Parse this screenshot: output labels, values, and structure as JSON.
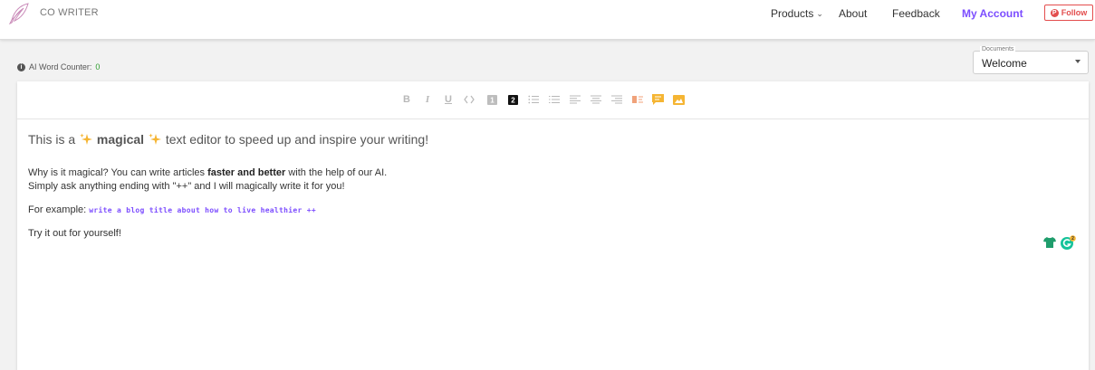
{
  "app": {
    "brand": "CO WRITER",
    "logo_icon": "feather-pen-icon"
  },
  "nav": {
    "products": "Products",
    "about": "About",
    "feedback": "Feedback",
    "my_account": "My Account",
    "follow": "Follow",
    "accent_color": "#7c4dff",
    "follow_color": "#e34d4d"
  },
  "counter": {
    "label": "AI Word Counter:",
    "value": "0"
  },
  "documents": {
    "legend": "Documents",
    "selected": "Welcome"
  },
  "toolbar": {
    "buttons": [
      "bold",
      "italic",
      "underline",
      "code",
      "heading-1",
      "heading-2",
      "ordered-list",
      "bullet-list",
      "align-left",
      "align-center",
      "align-right",
      "ai-tool",
      "comment",
      "image"
    ]
  },
  "editor": {
    "heading_pre": "This is a",
    "heading_bold": "magical",
    "heading_post": "text editor to speed up and inspire your writing!",
    "p1_pre": "Why is it magical? You can write articles ",
    "p1_bold": "faster and better",
    "p1_post": " with the help of our AI.",
    "p2": "Simply ask anything ending with \"++\" and I will magically write it for you!",
    "p3_label": "For example:",
    "p3_code": "write a blog title about how to live healthier ++",
    "p4": "Try it out for yourself!",
    "grammarly_badge": "2"
  }
}
